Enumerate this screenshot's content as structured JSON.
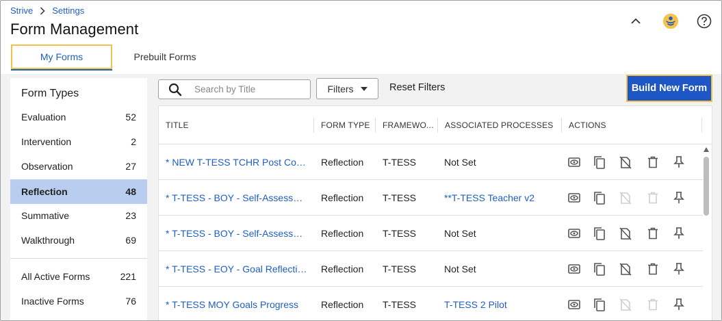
{
  "breadcrumb": {
    "root": "Strive",
    "current": "Settings"
  },
  "page": {
    "title": "Form Management"
  },
  "tabs": [
    {
      "label": "My Forms",
      "active": true
    },
    {
      "label": "Prebuilt Forms",
      "active": false
    }
  ],
  "sidebar": {
    "title": "Form Types",
    "types": [
      {
        "label": "Evaluation",
        "count": "52"
      },
      {
        "label": "Intervention",
        "count": "2"
      },
      {
        "label": "Observation",
        "count": "27"
      },
      {
        "label": "Reflection",
        "count": "48",
        "active": true
      },
      {
        "label": "Summative",
        "count": "23"
      },
      {
        "label": "Walkthrough",
        "count": "69"
      }
    ],
    "status": [
      {
        "label": "All Active Forms",
        "count": "221"
      },
      {
        "label": "Inactive Forms",
        "count": "76"
      }
    ]
  },
  "toolbar": {
    "search_placeholder": "Search by Title",
    "filters_label": "Filters",
    "reset_label": "Reset Filters",
    "build_label": "Build New Form"
  },
  "table": {
    "columns": [
      "TITLE",
      "FORM TYPE",
      "FRAMEWO...",
      "ASSOCIATED PROCESSES",
      "ACTIONS"
    ],
    "rows": [
      {
        "title": "* NEW T-TESS TCHR Post Conf ...",
        "type": "Reflection",
        "framework": "T-TESS",
        "process": "Not Set",
        "process_link": false,
        "actions_enabled": true
      },
      {
        "title": "* T-TESS - BOY - Self-Assessme...",
        "type": "Reflection",
        "framework": "T-TESS",
        "process": "**T-TESS Teacher v2",
        "process_link": true,
        "actions_enabled": false
      },
      {
        "title": "* T-TESS - BOY - Self-Assessme...",
        "type": "Reflection",
        "framework": "T-TESS",
        "process": "Not Set",
        "process_link": false,
        "actions_enabled": true
      },
      {
        "title": "* T-TESS - EOY - Goal Reflection...",
        "type": "Reflection",
        "framework": "T-TESS",
        "process": "Not Set",
        "process_link": false,
        "actions_enabled": true
      },
      {
        "title": "* T-TESS MOY Goals Progress",
        "type": "Reflection",
        "framework": "T-TESS",
        "process": "T-TESS 2 Pilot",
        "process_link": true,
        "actions_enabled": false
      }
    ]
  },
  "icons": {
    "breadcrumb_sep": "chevron-right-icon",
    "collapse": "chevron-up-icon",
    "avatar": "user-avatar-icon",
    "help": "help-circle-icon",
    "search": "search-icon",
    "filters": "caret-down-icon",
    "actions": [
      "preview-icon",
      "copy-icon",
      "deactivate-icon",
      "delete-icon",
      "pin-icon"
    ]
  },
  "colors": {
    "accent": "#1f5fbf",
    "primary_button": "#1e56c6",
    "highlight": "#f0c24b",
    "active_row": "#b9cdee",
    "icon": "#555555",
    "icon_disabled": "#cfcfcf"
  }
}
